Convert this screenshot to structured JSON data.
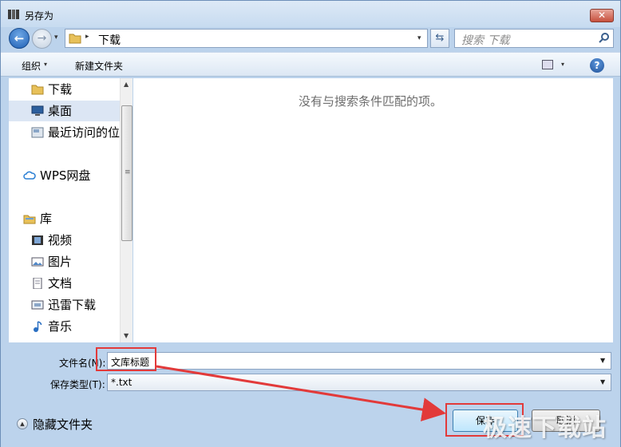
{
  "window": {
    "title": "另存为",
    "close_label": "✕"
  },
  "navigation": {
    "back_glyph": "←",
    "forward_glyph": "→",
    "dropdown_glyph": "▾",
    "address": {
      "separator": "▸",
      "location": "下载",
      "dropdown_glyph": "▾"
    },
    "refresh_glyph": "⇆",
    "search": {
      "placeholder": "搜索 下载"
    }
  },
  "toolbar": {
    "organize_label": "组织",
    "organize_arrow": "▾",
    "new_folder_label": "新建文件夹",
    "view_arrow": "▾",
    "help_label": "?"
  },
  "sidebar": {
    "items": [
      {
        "label": "下载",
        "icon": "folder-icon"
      },
      {
        "label": "桌面",
        "icon": "desktop-icon"
      },
      {
        "label": "最近访问的位",
        "icon": "recent-places-icon"
      },
      {
        "label": "WPS网盘",
        "icon": "cloud-icon"
      },
      {
        "label": "库",
        "icon": "library-icon"
      },
      {
        "label": "视频",
        "icon": "video-icon"
      },
      {
        "label": "图片",
        "icon": "picture-icon"
      },
      {
        "label": "文档",
        "icon": "document-icon"
      },
      {
        "label": "迅雷下载",
        "icon": "download-icon"
      },
      {
        "label": "音乐",
        "icon": "music-icon"
      }
    ],
    "selected": "桌面",
    "scroll_up": "▲",
    "scroll_down": "▼",
    "scroll_grip": "≡"
  },
  "content": {
    "empty_message": "没有与搜索条件匹配的项。"
  },
  "form": {
    "filename_label": "文件名(N):",
    "filename_value": "文库标题",
    "filename_drop": "▼",
    "filetype_label": "保存类型(T):",
    "filetype_value": "*.txt",
    "filetype_drop": "▼"
  },
  "footer": {
    "hide_folders_label": "隐藏文件夹",
    "hide_folders_glyph": "▲",
    "save_label": "保存",
    "cancel_label": "取消"
  },
  "watermark": "极速下载站",
  "colors": {
    "highlight": "#e23a3a",
    "window_bg": "#bcd3ec"
  }
}
